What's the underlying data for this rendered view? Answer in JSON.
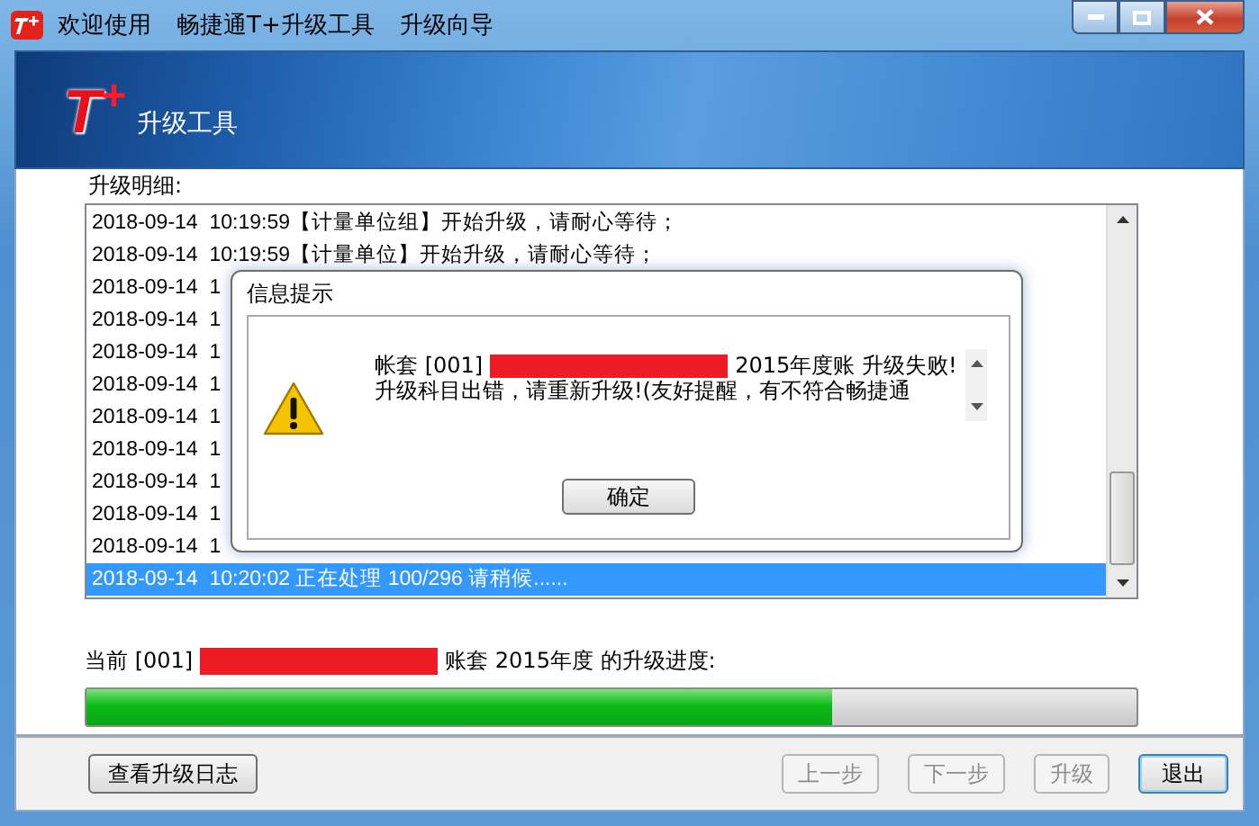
{
  "window": {
    "title_parts": [
      "欢迎使用",
      "畅捷通T+升级工具",
      "升级向导"
    ]
  },
  "banner": {
    "logo": "T$^{+}$",
    "subtitle": "升级工具"
  },
  "details": {
    "label": "升级明细:",
    "rows": [
      {
        "text": "2018-09-14  10:19:59【计量单位组】开始升级，请耐心等待；",
        "selected": false
      },
      {
        "text": "2018-09-14  10:19:59【计量单位】开始升级，请耐心等待；",
        "selected": false
      },
      {
        "text": "2018-09-14  1",
        "selected": false
      },
      {
        "text": "2018-09-14  1",
        "selected": false
      },
      {
        "text": "2018-09-14  1",
        "selected": false
      },
      {
        "text": "2018-09-14  1",
        "selected": false
      },
      {
        "text": "2018-09-14  1",
        "selected": false
      },
      {
        "text": "2018-09-14  1",
        "selected": false
      },
      {
        "text": "2018-09-14  1",
        "selected": false
      },
      {
        "text": "2018-09-14  1",
        "selected": false
      },
      {
        "text": "2018-09-14  1",
        "selected": false
      },
      {
        "text": "2018-09-14  10:20:02 正在处理 100/296 请稍候......",
        "selected": true
      }
    ]
  },
  "progress": {
    "prefix": "当前 [001]",
    "suffix": "账套 2015年度 的升级进度:",
    "level": 0.71
  },
  "buttons": [
    {
      "label": "查看升级日志",
      "disabled": false,
      "default": false
    },
    {
      "label": "上一步",
      "disabled": true,
      "default": false
    },
    {
      "label": "下一步",
      "disabled": true,
      "default": false
    },
    {
      "label": "升级",
      "disabled": true,
      "default": false
    },
    {
      "label": "退出",
      "disabled": false,
      "default": true
    }
  ],
  "dialog": {
    "title": "信息提示",
    "message_prefix": "帐套 [001]",
    "message_suffix": "2015年度账 升级失败!",
    "message_detail": "升级科目出错，请重新升级!(友好提醒，有不符合畅捷通",
    "button": "确定"
  }
}
